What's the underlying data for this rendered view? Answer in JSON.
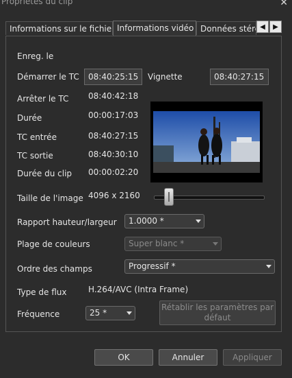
{
  "window": {
    "title": "Propriétés du clip",
    "close_icon": "close-icon"
  },
  "tabs": [
    {
      "label": "Informations sur le fichier",
      "active": false
    },
    {
      "label": "Informations vidéo",
      "active": true
    },
    {
      "label": "Données stéré",
      "active": false
    }
  ],
  "tab_nav": {
    "prev": "◀",
    "next": "▶"
  },
  "fields": {
    "enreg_label": "Enreg. le",
    "demarrer_label": "Démarrer le TC",
    "demarrer_value": "08:40:25:15",
    "vignette_label": "Vignette",
    "vignette_value": "08:40:27:15",
    "arreter_label": "Arrêter le TC",
    "arreter_value": "08:40:42:18",
    "duree_label": "Durée",
    "duree_value": "00:00:17:03",
    "tc_entree_label": "TC entrée",
    "tc_entree_value": "08:40:27:15",
    "tc_sortie_label": "TC sortie",
    "tc_sortie_value": "08:40:30:10",
    "duree_clip_label": "Durée du clip",
    "duree_clip_value": "00:00:02:20",
    "taille_label": "Taille de l'image",
    "taille_value": "4096 x 2160",
    "rapport_label": "Rapport hauteur/largeur",
    "rapport_value": "1.0000 *",
    "plage_label": "Plage de couleurs",
    "plage_value": "Super blanc *",
    "ordre_label": "Ordre des champs",
    "ordre_value": "Progressif *",
    "type_flux_label": "Type de flux",
    "type_flux_value": "H.264/AVC (Intra Frame)",
    "frequence_label": "Fréquence",
    "frequence_value": "25 *"
  },
  "slider": {
    "position_fraction": 0.1
  },
  "reset_button": {
    "line1": "Rétablir les paramètres par",
    "line2": "défaut"
  },
  "buttons": {
    "ok": "OK",
    "annuler": "Annuler",
    "appliquer": "Appliquer"
  },
  "colors": {
    "background": "#2c2c2c",
    "text": "#e6e6e6",
    "disabled_text": "#8a8a8a"
  }
}
